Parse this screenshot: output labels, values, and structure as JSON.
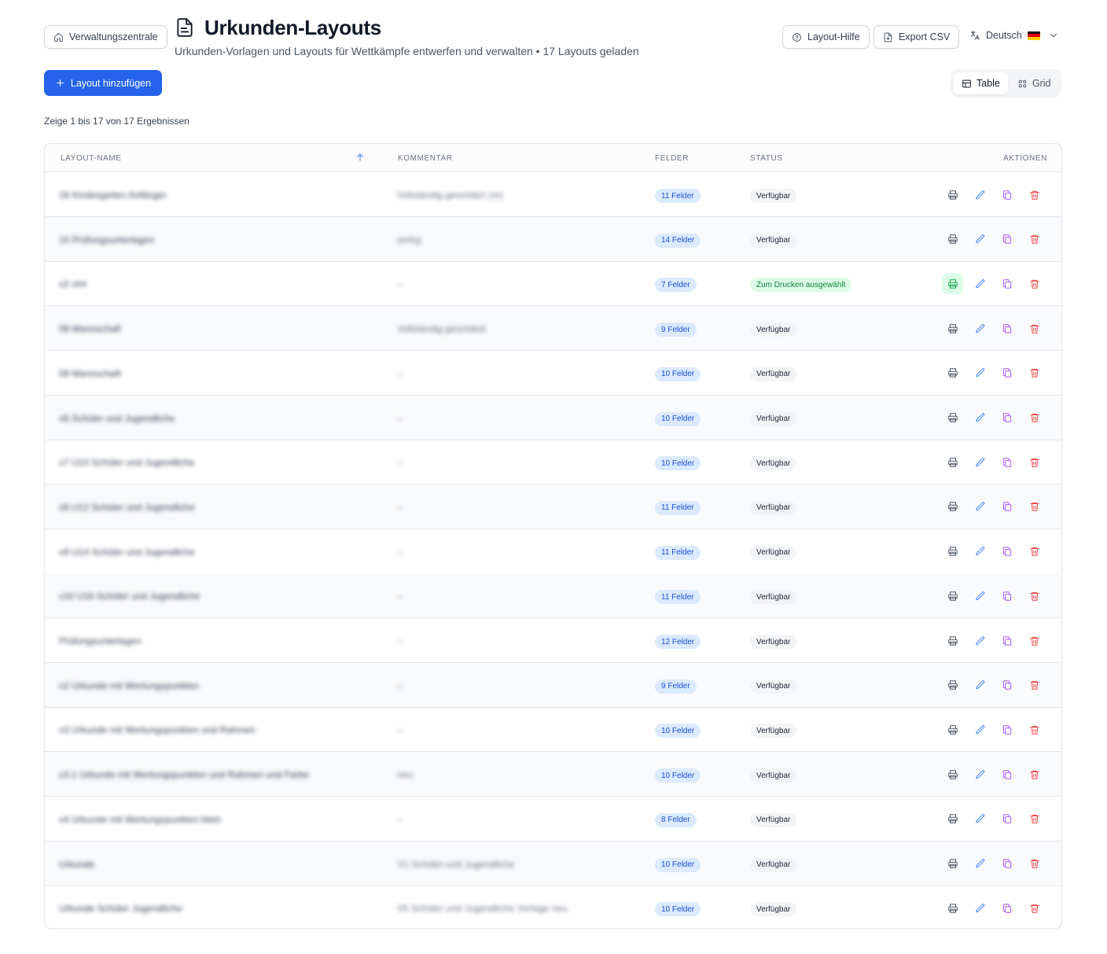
{
  "header": {
    "home_label": "Verwaltungszentrale",
    "title": "Urkunden-Layouts",
    "subtitle": "Urkunden-Vorlagen und Layouts für Wettkämpfe entwerfen und verwalten • 17 Layouts geladen",
    "help_label": "Layout-Hilfe",
    "export_label": "Export CSV",
    "language_label": "Deutsch"
  },
  "toolbar": {
    "add_label": "Layout hinzufügen",
    "view_table": "Table",
    "view_grid": "Grid",
    "active_view": "Table"
  },
  "results_info": "Zeige 1 bis 17 von 17 Ergebnissen",
  "table": {
    "columns": {
      "name": "Layout-Name",
      "comment": "Kommentar",
      "fields": "Felder",
      "status": "Status",
      "actions": "Aktionen"
    },
    "sort": "layout-name ascending",
    "rows": [
      {
        "name": "16 Kindergarten Anfänger",
        "comment": "Vollständig geschätzt (re)",
        "fields": "11 Felder",
        "status": "Verfügbar",
        "selected": false
      },
      {
        "name": "15 Prüfungsunterlagen",
        "comment": "eintrg",
        "fields": "14 Felder",
        "status": "Verfügbar",
        "selected": false
      },
      {
        "name": "v2 clnt",
        "comment": "–",
        "fields": "7 Felder",
        "status": "Zum Drucken ausgewählt",
        "selected": true
      },
      {
        "name": "08 Mannschaft",
        "comment": "Vollständig geschätzt",
        "fields": "9 Felder",
        "status": "Verfügbar",
        "selected": false
      },
      {
        "name": "09 Mannschaft",
        "comment": "–",
        "fields": "10 Felder",
        "status": "Verfügbar",
        "selected": false
      },
      {
        "name": "v6 Schüler und Jugendliche",
        "comment": "–",
        "fields": "10 Felder",
        "status": "Verfügbar",
        "selected": false
      },
      {
        "name": "v7 U10 Schüler und Jugendliche",
        "comment": "–",
        "fields": "10 Felder",
        "status": "Verfügbar",
        "selected": false
      },
      {
        "name": "v8 U12 Schüler und Jugendliche",
        "comment": "–",
        "fields": "11 Felder",
        "status": "Verfügbar",
        "selected": false
      },
      {
        "name": "v9 U14 Schüler und Jugendliche",
        "comment": "–",
        "fields": "11 Felder",
        "status": "Verfügbar",
        "selected": false
      },
      {
        "name": "v10 U16 Schüler und Jugendliche",
        "comment": "–",
        "fields": "11 Felder",
        "status": "Verfügbar",
        "selected": false
      },
      {
        "name": "Prüfungsunterlagen",
        "comment": "–",
        "fields": "12 Felder",
        "status": "Verfügbar",
        "selected": false
      },
      {
        "name": "v2 Urkunde mit Wertungspunkten",
        "comment": "–",
        "fields": "9 Felder",
        "status": "Verfügbar",
        "selected": false
      },
      {
        "name": "v3 Urkunde mit Wertungspunkten und Rahmen",
        "comment": "–",
        "fields": "10 Felder",
        "status": "Verfügbar",
        "selected": false
      },
      {
        "name": "v3.1 Urkunde mit Wertungspunkten und Rahmen und Farbe",
        "comment": "neu",
        "fields": "10 Felder",
        "status": "Verfügbar",
        "selected": false
      },
      {
        "name": "v4 Urkunde mit Wertungspunkten klein",
        "comment": "–",
        "fields": "8 Felder",
        "status": "Verfügbar",
        "selected": false
      },
      {
        "name": "Urkunde",
        "comment": "V1 Schüler und Jugendliche",
        "fields": "10 Felder",
        "status": "Verfügbar",
        "selected": false
      },
      {
        "name": "Urkunde Schüler Jugendliche",
        "comment": "V5 Schüler und Jugendliche Vorlage neu",
        "fields": "10 Felder",
        "status": "Verfügbar",
        "selected": false
      }
    ]
  },
  "icons": {
    "home": "home-icon",
    "title": "document-icon",
    "help": "help-circle-icon",
    "export": "file-export-icon",
    "language": "translate-icon",
    "flag": "german-flag-icon",
    "dropdown": "chevron-down-icon",
    "add": "plus-icon",
    "table_view": "table-icon",
    "grid_view": "grid-icon",
    "sort": "arrow-up-icon",
    "print": "printer-icon",
    "edit": "pencil-icon",
    "copy": "copy-icon",
    "delete": "trash-icon"
  },
  "colors": {
    "primary": "#2563eb",
    "fields_badge_bg": "#dbeafe",
    "fields_badge_text": "#1d4ed8",
    "selected_bg": "#dcfce7",
    "selected_text": "#15803d",
    "edit": "#3b82f6",
    "copy": "#a855f7",
    "delete": "#ef4444"
  }
}
